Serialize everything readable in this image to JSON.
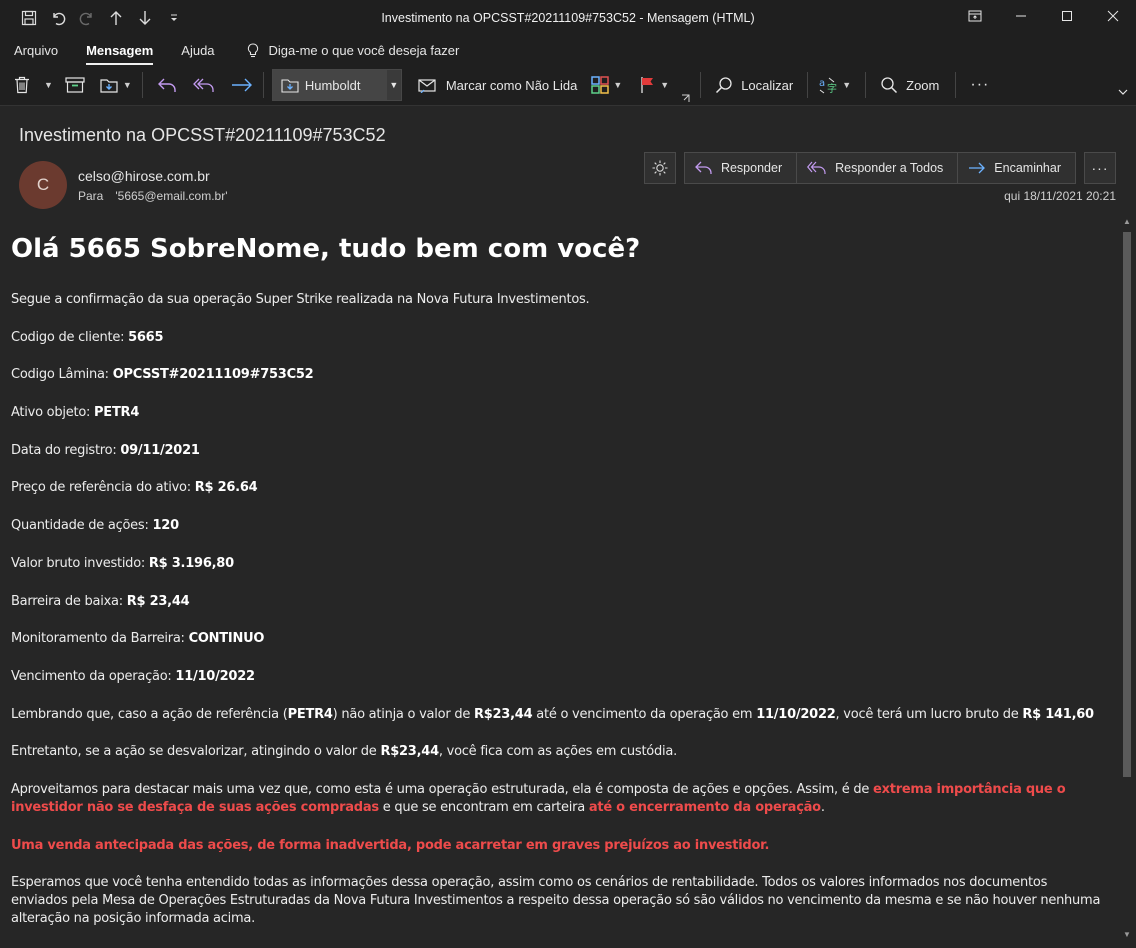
{
  "window": {
    "title": "Investimento na OPCSST#20211109#753C52  -  Mensagem (HTML)"
  },
  "menu": {
    "items": [
      "Arquivo",
      "Mensagem",
      "Ajuda"
    ],
    "tell_me": "Diga-me o que você deseja fazer"
  },
  "ribbon": {
    "quick_step": "Humboldt",
    "mark_unread": "Marcar como Não Lida",
    "find": "Localizar",
    "zoom": "Zoom",
    "more": "···"
  },
  "message": {
    "subject": "Investimento na OPCSST#20211109#753C52",
    "avatar_initial": "C",
    "sender": "celso@hirose.com.br",
    "to_label": "Para",
    "to_value": "'5665@email.com.br'",
    "date": "qui 18/11/2021 20:21",
    "actions": {
      "reply": "Responder",
      "reply_all": "Responder a Todos",
      "forward": "Encaminhar",
      "more": "···"
    }
  },
  "body": {
    "heading": "Olá 5665 SobreNome, tudo bem com você?",
    "intro": "Segue a confirmação da sua operação Super Strike realizada na Nova Futura Investimentos.",
    "fields": [
      {
        "label": "Codigo de cliente: ",
        "value": "5665"
      },
      {
        "label": "Codigo Lâmina: ",
        "value": "OPCSST#20211109#753C52"
      },
      {
        "label": "Ativo objeto: ",
        "value": "PETR4"
      },
      {
        "label": "Data do registro: ",
        "value": "09/11/2021"
      },
      {
        "label": "Preço de referência do ativo: ",
        "value": "R$ 26.64"
      },
      {
        "label": "Quantidade de ações: ",
        "value": "120"
      },
      {
        "label": "Valor bruto investido: ",
        "value": "R$ 3.196,80"
      },
      {
        "label": "Barreira de baixa: ",
        "value": "R$ 23,44"
      },
      {
        "label": "Monitoramento da Barreira: ",
        "value": "CONTINUO"
      },
      {
        "label": "Vencimento da operação: ",
        "value": "11/10/2022"
      }
    ],
    "reminder": {
      "t1": "Lembrando que, caso a ação de referência (",
      "b1": "PETR4",
      "t2": ") não atinja o valor de ",
      "b2": "R$23,44",
      "t3": " até o vencimento da operação em ",
      "b3": "11/10/2022",
      "t4": ", você terá um lucro bruto de ",
      "b4": "R$ 141,60"
    },
    "however": {
      "t1": "Entretanto, se a ação se desvalorizar, atingindo o valor de ",
      "b1": "R$23,44",
      "t2": ", você fica com as ações em custódia."
    },
    "highlight": {
      "t1": "Aproveitamos para destacar mais uma vez que, como esta é uma operação estruturada, ela é composta de ações e opções. Assim, é de ",
      "r1": "extrema importância que o investidor não se desfaça de suas ações compradas",
      "t2": " e que se encontram em carteira ",
      "r2": "até o encerramento da operação",
      "t3": "."
    },
    "warning": "Uma venda antecipada das ações, de forma inadvertida, pode acarretar em graves prejuízos ao investidor.",
    "closing": "Esperamos que você tenha entendido todas as informações dessa operação, assim como os cenários de rentabilidade. Todos os valores informados nos documentos enviados pela Mesa de Operações Estruturadas da Nova Futura Investimentos a respeito dessa operação só são válidos no vencimento da mesma e se não houver nenhuma alteração na posição informada acima."
  },
  "colors": {
    "background": "#262626",
    "chrome": "#1f1f1f",
    "warning_red": "#ee4b4b",
    "avatar": "#6b3a2f",
    "reply_purple": "#c39bf0",
    "forward_blue": "#6cb2ff"
  }
}
